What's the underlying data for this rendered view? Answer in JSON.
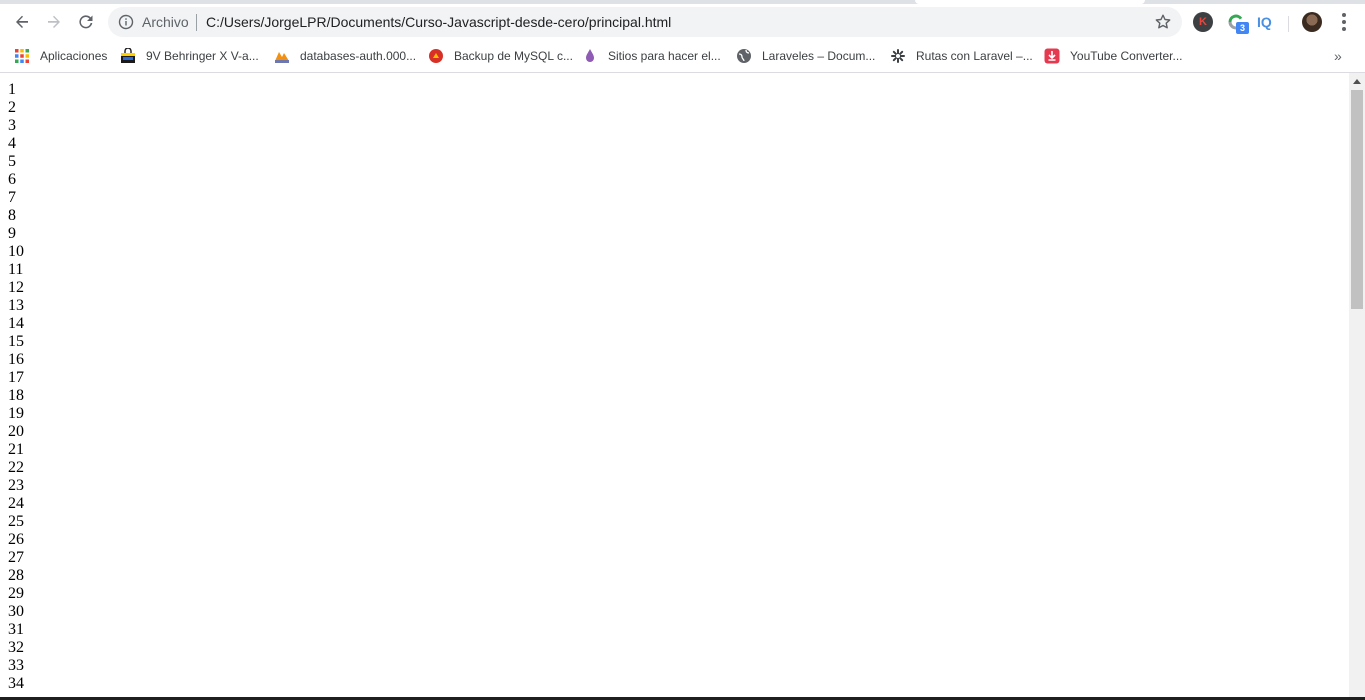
{
  "browser": {
    "omnibox": {
      "scheme_label": "Archivo",
      "url": "C:/Users/JorgeLPR/Documents/Curso-Javascript-desde-cero/principal.html"
    },
    "icons": {
      "back": "back-arrow-icon",
      "forward": "forward-arrow-icon",
      "reload": "reload-icon",
      "info": "info-icon",
      "bookmark_star": "star-icon",
      "menu": "kebab-menu-icon"
    },
    "extensions": {
      "k_label": "K",
      "g_badge": "3",
      "iq_label": "IQ"
    }
  },
  "bookmarks": [
    {
      "label": "Aplicaciones",
      "icon": "apps-grid-icon"
    },
    {
      "label": "9V Behringer X V-a...",
      "icon": "shopping-bag-icon"
    },
    {
      "label": "databases-auth.000...",
      "icon": "phpmyadmin-icon"
    },
    {
      "label": "Backup de MySQL c...",
      "icon": "red-circle-icon"
    },
    {
      "label": "Sitios para hacer el...",
      "icon": "purple-drop-icon"
    },
    {
      "label": "Laraveles – Docum...",
      "icon": "globe-icon"
    },
    {
      "label": "Rutas con Laravel –...",
      "icon": "star-burst-icon"
    },
    {
      "label": "YouTube Converter...",
      "icon": "download-icon"
    }
  ],
  "bookmarks_more": "»",
  "page": {
    "lines": [
      "1",
      "2",
      "3",
      "4",
      "5",
      "6",
      "7",
      "8",
      "9",
      "10",
      "11",
      "12",
      "13",
      "14",
      "15",
      "16",
      "17",
      "18",
      "19",
      "20",
      "21",
      "22",
      "23",
      "24",
      "25",
      "26",
      "27",
      "28",
      "29",
      "30",
      "31",
      "32",
      "33",
      "34"
    ]
  },
  "colors": {
    "omnibox_bg": "#f1f3f4",
    "scroll_thumb": "#c1c1c1"
  }
}
